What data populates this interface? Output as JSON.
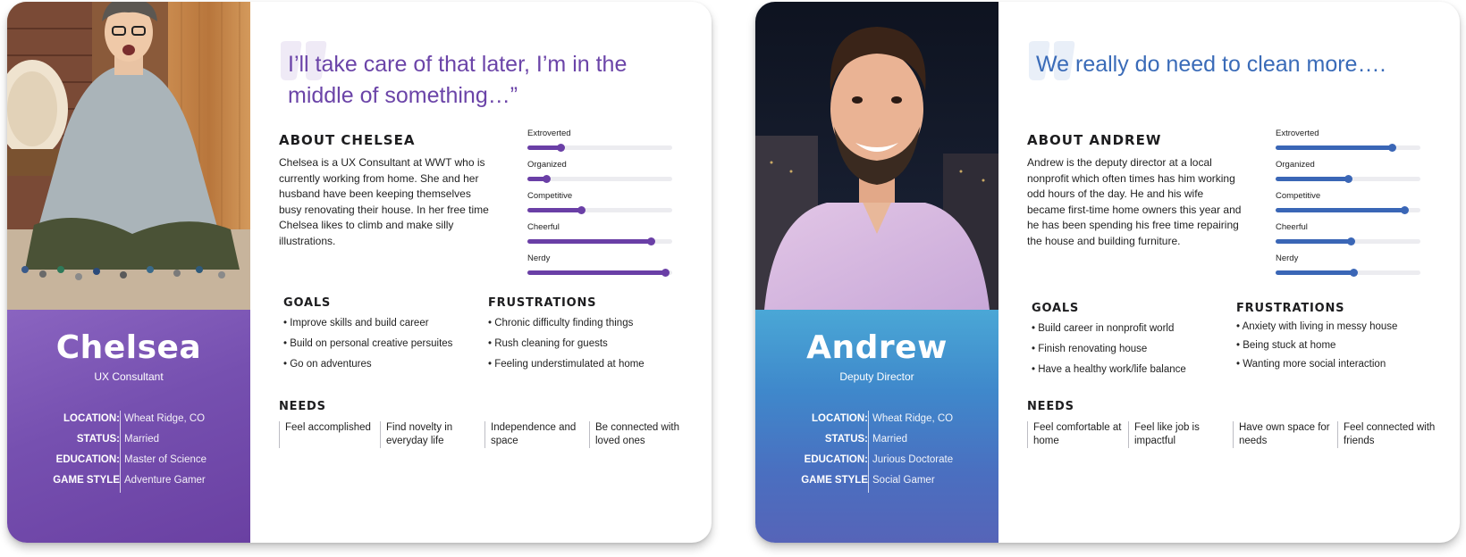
{
  "personas": [
    {
      "name": "Chelsea",
      "role": "UX Consultant",
      "quote": "I’ll take care of that later, I’m in the middle of something…”",
      "about_title": "ABOUT CHELSEA",
      "about_text": "Chelsea is a UX Consultant at WWT who is currently working from home.  She and her husband have been keeping themselves busy renovating their house. In her free time Chelsea likes to climb and make silly illustrations.",
      "facts": [
        {
          "label": "LOCATION:",
          "value": "Wheat Ridge, CO"
        },
        {
          "label": "STATUS:",
          "value": "Married"
        },
        {
          "label": "EDUCATION:",
          "value": "Master of Science"
        },
        {
          "label": "GAME STYLE",
          "value": "Adventure Gamer"
        }
      ],
      "traits": [
        {
          "label": "Extroverted",
          "level": 0.23
        },
        {
          "label": "Organized",
          "level": 0.13
        },
        {
          "label": "Competitive",
          "level": 0.37
        },
        {
          "label": "Cheerful",
          "level": 0.85
        },
        {
          "label": "Nerdy",
          "level": 0.95
        }
      ],
      "goals_title": "GOALS",
      "goals": [
        "• Improve skills and build career",
        "• Build on personal creative persuites",
        "• Go on adventures"
      ],
      "frustrations_title": "FRUSTRATIONS",
      "frustrations": [
        "• Chronic difficulty finding things",
        "• Rush cleaning for guests",
        "• Feeling understimulated at home"
      ],
      "needs_title": "NEEDS",
      "needs": [
        "Feel accomplished",
        "Find novelty in everyday life",
        "Independence and space",
        "Be connected with loved ones"
      ],
      "accent": "#6b44a8"
    },
    {
      "name": "Andrew",
      "role": "Deputy Director",
      "quote": "We really do need to clean more….",
      "about_title": "ABOUT ANDREW",
      "about_text": "Andrew is the deputy director at a local nonprofit which often times has him working odd hours of the day.  He and his wife became first-time home owners this year and he has been spending his free time repairing the house and building furniture.",
      "facts": [
        {
          "label": "LOCATION:",
          "value": "Wheat Ridge, CO"
        },
        {
          "label": "STATUS:",
          "value": "Married"
        },
        {
          "label": "EDUCATION:",
          "value": "Jurious Doctorate"
        },
        {
          "label": "GAME STYLE",
          "value": "Social Gamer"
        }
      ],
      "traits": [
        {
          "label": "Extroverted",
          "level": 0.8
        },
        {
          "label": "Organized",
          "level": 0.5
        },
        {
          "label": "Competitive",
          "level": 0.89
        },
        {
          "label": "Cheerful",
          "level": 0.52
        },
        {
          "label": "Nerdy",
          "level": 0.54
        }
      ],
      "goals_title": "GOALS",
      "goals": [
        "• Build career in nonprofit world",
        "• Finish renovating house",
        "• Have a healthy work/life balance"
      ],
      "frustrations_title": "FRUSTRATIONS",
      "frustrations": [
        "• Anxiety with living in messy house",
        "• Being stuck at home",
        "• Wanting more social interaction"
      ],
      "needs_title": "NEEDS",
      "needs": [
        "Feel comfortable at home",
        "Feel like job is impactful",
        "Have own space for needs",
        "Feel connected with friends"
      ],
      "accent": "#3a6bb8"
    }
  ]
}
